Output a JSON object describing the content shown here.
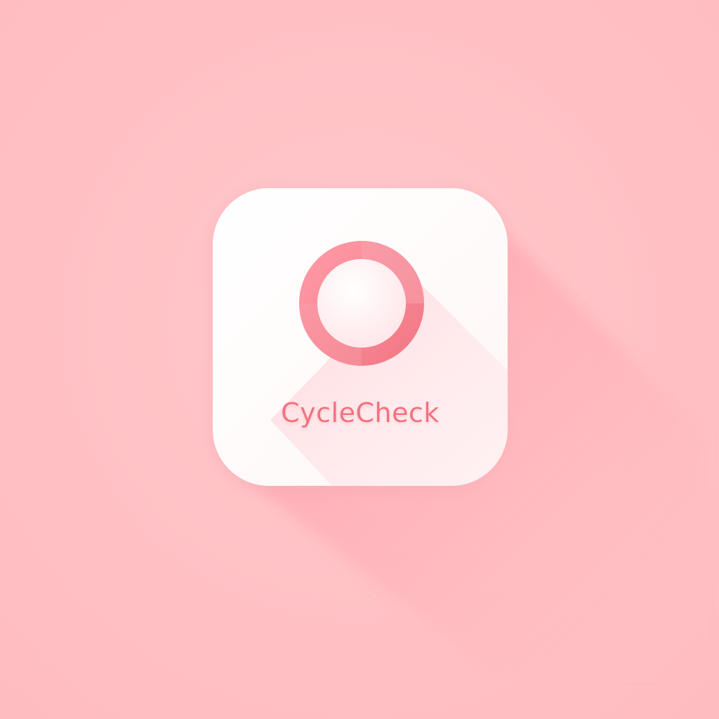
{
  "app": {
    "name": "CycleCheck"
  },
  "icons": {
    "logo": "cycle-ring-icon"
  },
  "colors": {
    "background": "#ffc3c6",
    "tile": "#ffffff",
    "accent": "#f2727f",
    "ring": "#f6909b",
    "shadow": "#ff8a98"
  }
}
